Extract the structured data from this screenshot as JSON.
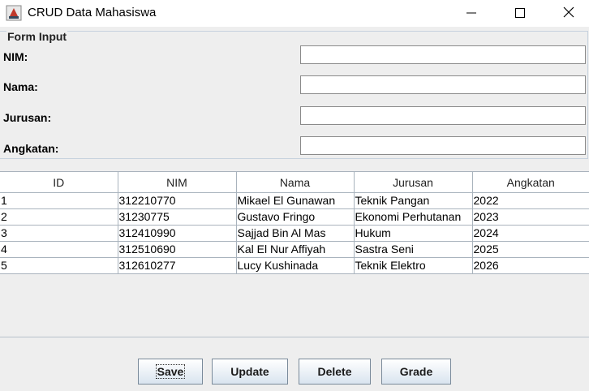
{
  "window": {
    "title": "CRUD Data Mahasiswa"
  },
  "form": {
    "legend": "Form Input",
    "nim_label": "NIM:",
    "nama_label": "Nama:",
    "jurusan_label": "Jurusan:",
    "angkatan_label": "Angkatan:",
    "nim_value": "",
    "nama_value": "",
    "jurusan_value": "",
    "angkatan_value": ""
  },
  "table": {
    "columns": [
      "ID",
      "NIM",
      "Nama",
      "Jurusan",
      "Angkatan"
    ],
    "rows": [
      [
        "1",
        "312210770",
        "Mikael El Gunawan",
        "Teknik Pangan",
        "2022"
      ],
      [
        "2",
        "31230775",
        "Gustavo Fringo",
        "Ekonomi Perhutanan",
        "2023"
      ],
      [
        "3",
        "312410990",
        "Sajjad Bin Al Mas",
        "Hukum",
        "2024"
      ],
      [
        "4",
        "312510690",
        "Kal El Nur Affiyah",
        "Sastra Seni",
        "2025"
      ],
      [
        "5",
        "312610277",
        "Lucy Kushinada",
        "Teknik Elektro",
        "2026"
      ]
    ]
  },
  "buttons": {
    "save": "Save",
    "update": "Update",
    "delete": "Delete",
    "grade": "Grade"
  },
  "icons": {
    "app": "java-cup-icon",
    "minimize": "minimize-icon",
    "maximize": "maximize-icon",
    "close": "close-icon"
  }
}
